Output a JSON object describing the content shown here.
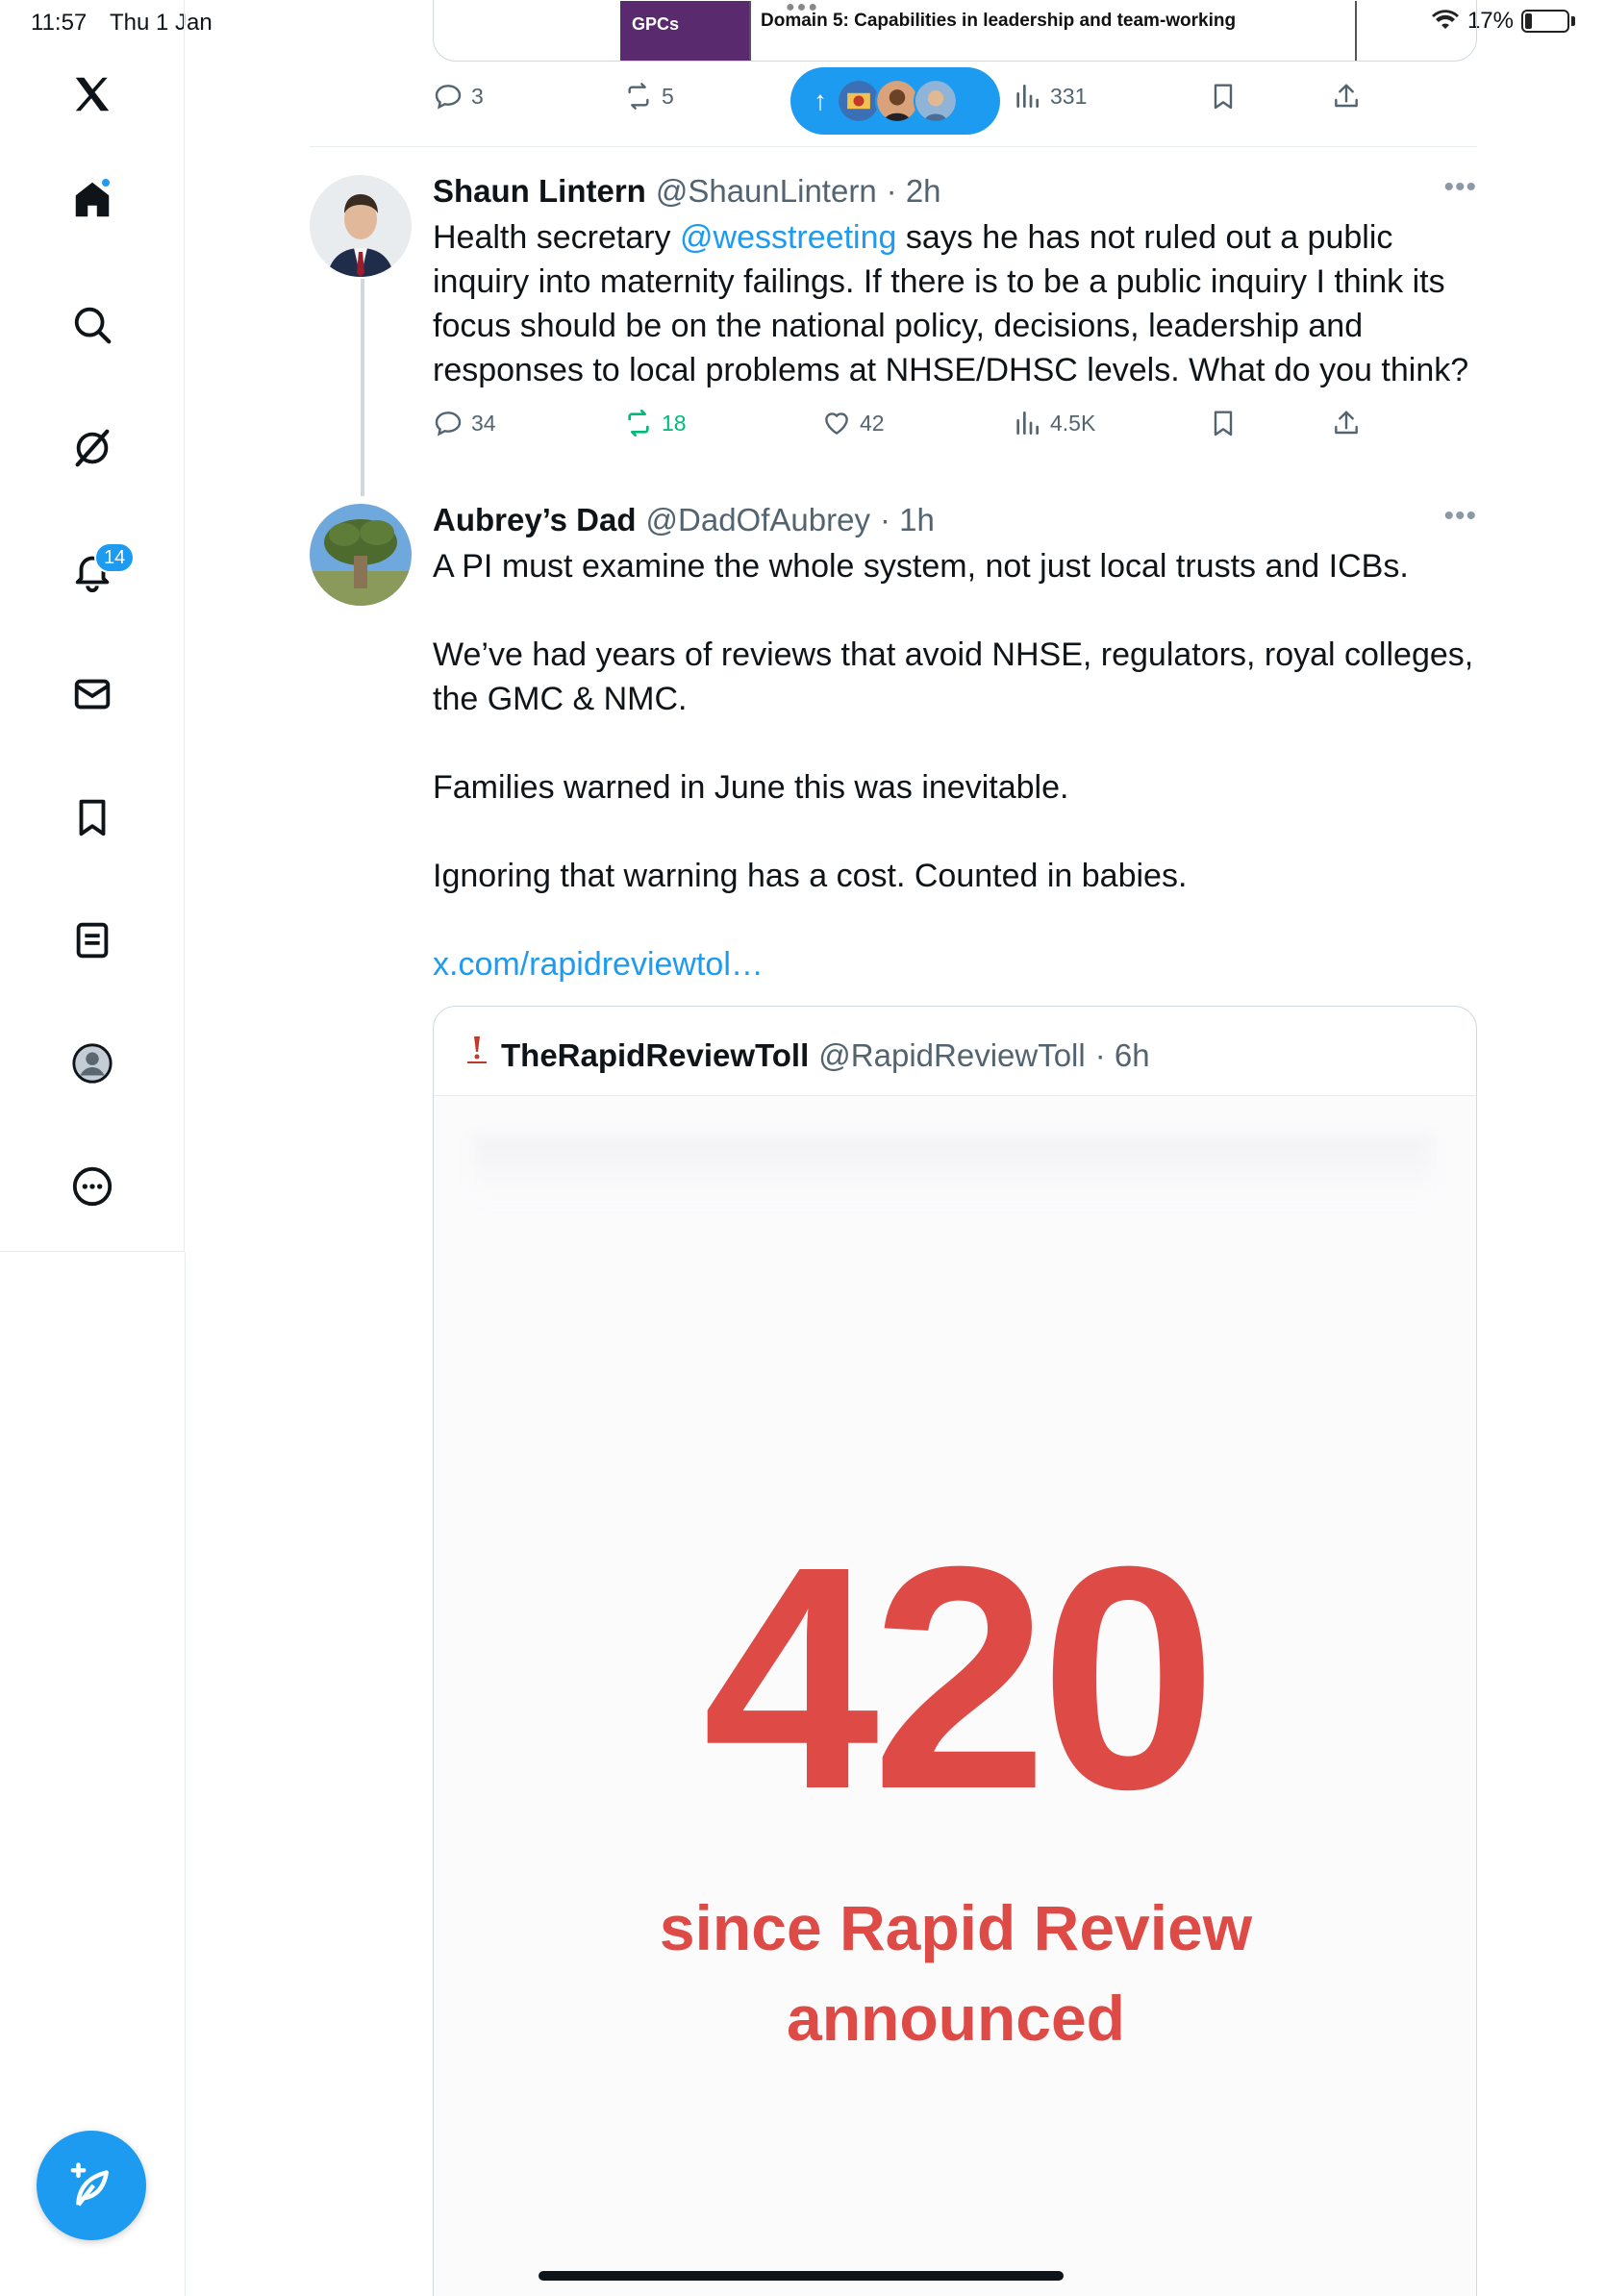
{
  "status_bar": {
    "time": "11:57",
    "date": "Thu 1 Jan",
    "battery": "17%",
    "battery_level": 0.17
  },
  "sidebar": {
    "items": [
      {
        "name": "x-logo-icon"
      },
      {
        "name": "home-icon"
      },
      {
        "name": "search-icon"
      },
      {
        "name": "grok-icon"
      },
      {
        "name": "notifications-icon",
        "badge": "14"
      },
      {
        "name": "messages-icon"
      },
      {
        "name": "bookmarks-icon"
      },
      {
        "name": "lists-icon"
      },
      {
        "name": "profile-icon"
      },
      {
        "name": "more-icon"
      }
    ],
    "compose": {
      "icon": "compose-icon"
    }
  },
  "previous_tweet": {
    "card_gpcs": "GPCs",
    "card_domain": "Domain 5: Capabilities in leadership and team-working",
    "replies": "3",
    "reposts": "5",
    "views": "331"
  },
  "new_posts_pill": {
    "icon": "arrow-up-icon"
  },
  "tweets": [
    {
      "name": "Shaun Lintern",
      "handle": "@ShaunLintern",
      "time": "· 2h",
      "body_pre": "Health secretary ",
      "mention": "@wesstreeting",
      "body_post": " says he has not ruled out a public inquiry into maternity failings. If there is to be a public inquiry I think its focus should be on the national policy, decisions, leadership and responses to local problems at NHSE/DHSC levels. What do you think?",
      "replies": "34",
      "reposts": "18",
      "likes": "42",
      "views": "4.5K"
    },
    {
      "name": "Aubrey’s Dad",
      "handle": "@DadOfAubrey",
      "time": "· 1h",
      "paragraphs": [
        "A PI must examine the whole system, not just local trusts and ICBs.",
        "We’ve had years of reviews that avoid NHSE, regulators, royal colleges, the GMC & NMC.",
        "Families warned in June this was inevitable.",
        "Ignoring that warning has a cost. Counted in babies."
      ],
      "link": "x.com/rapidreviewtol…",
      "quote": {
        "name": "TheRapidReviewToll",
        "handle": "@RapidReviewToll",
        "time": "· 6h",
        "big_number": "420",
        "caption_line1": "since Rapid Review",
        "caption_line2": "announced"
      }
    }
  ],
  "colors": {
    "accent": "#1d9bf0",
    "repost_green": "#00ba7c",
    "toll_red": "#de4b46"
  }
}
